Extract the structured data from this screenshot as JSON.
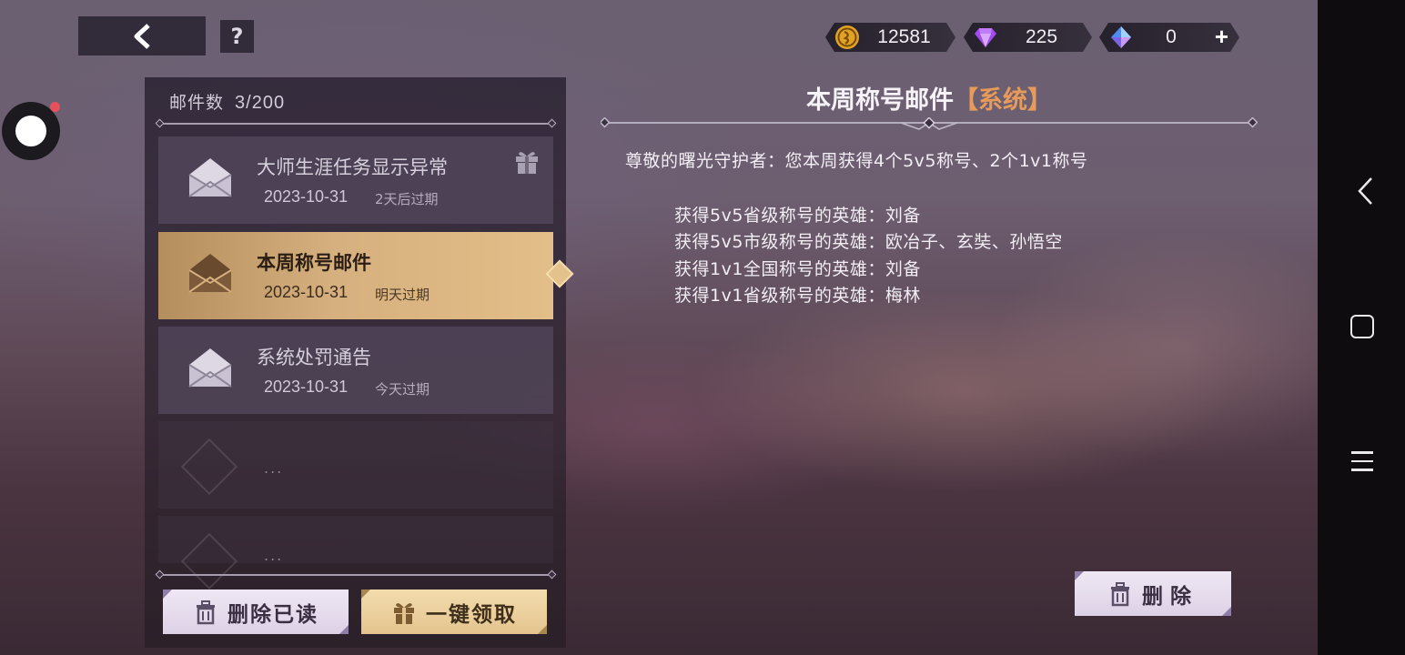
{
  "header": {
    "back_icon": "chevron-left-icon",
    "help_label": "?"
  },
  "currencies": [
    {
      "name": "gold-coin",
      "icon": "gold-coin-icon",
      "value": "12581"
    },
    {
      "name": "purple-diamond",
      "icon": "purple-diamond-icon",
      "value": "225"
    },
    {
      "name": "blue-crystal",
      "icon": "blue-crystal-icon",
      "value": "0",
      "add_label": "+"
    }
  ],
  "mailbox": {
    "count_label": "邮件数",
    "count_value": "3/200",
    "items": [
      {
        "title": "大师生涯任务显示异常",
        "date": "2023-10-31",
        "expire": "2天后过期",
        "has_gift": true,
        "active": false
      },
      {
        "title": "本周称号邮件",
        "date": "2023-10-31",
        "expire": "明天过期",
        "has_gift": false,
        "active": true
      },
      {
        "title": "系统处罚通告",
        "date": "2023-10-31",
        "expire": "今天过期",
        "has_gift": false,
        "active": false
      }
    ],
    "empty_placeholder": "...",
    "delete_read_label": "删除已读",
    "collect_all_label": "一键领取"
  },
  "detail": {
    "title": "本周称号邮件",
    "tag": "【系统】",
    "greeting": "尊敬的曙光守护者：您本周获得4个5v5称号、2个1v1称号",
    "lines": [
      "获得5v5省级称号的英雄：刘备",
      "获得5v5市级称号的英雄：欧冶子、玄奘、孙悟空",
      "获得1v1全国称号的英雄：刘备",
      "获得1v1省级称号的英雄：梅林"
    ],
    "delete_label": "删除"
  },
  "colors": {
    "active_mail": "#d6b07e",
    "tag_orange": "#e79a5a",
    "recording_red": "#e8505b"
  }
}
